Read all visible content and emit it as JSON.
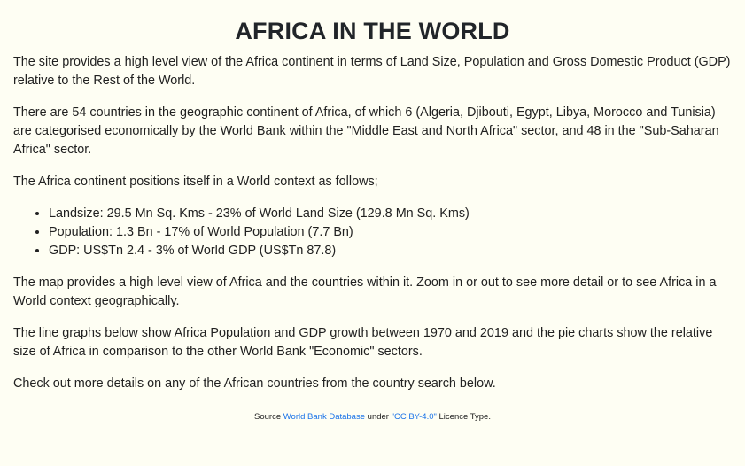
{
  "header": {
    "title": "AFRICA IN THE WORLD"
  },
  "content": {
    "p1": "The site provides a high level view of the Africa continent in terms of Land Size, Population and Gross Domestic Product (GDP) relative to the Rest of the World.",
    "p2": "There are 54 countries in the geographic continent of Africa, of which 6 (Algeria, Djibouti, Egypt, Libya, Morocco and Tunisia) are categorised economically by the World Bank within the \"Middle East and North Africa\" sector, and 48 in the \"Sub-Saharan Africa\" sector.",
    "p3": "The Africa continent positions itself in a World context as follows;",
    "bullets": [
      "Landsize: 29.5 Mn Sq. Kms - 23% of World Land Size (129.8 Mn Sq. Kms)",
      "Population: 1.3 Bn - 17% of World Population (7.7 Bn)",
      "GDP: US$Tn 2.4 - 3% of World GDP (US$Tn 87.8)"
    ],
    "p4": "The map provides a high level view of Africa and the countries within it. Zoom in or out to see more detail or to see Africa in a World context geographically.",
    "p5": "The line graphs below show Africa Population and GDP growth between 1970 and 2019 and the pie charts show the relative size of Africa in comparison to the other World Bank \"Economic\" sectors.",
    "p6": "Check out more details on any of the African countries from the country search below."
  },
  "footer": {
    "source_prefix": "Source ",
    "source_link": "World Bank Database",
    "source_middle": " under ",
    "license_link": "\"CC BY-4.0\"",
    "source_suffix": " Licence Type.",
    "link_color": "#1a73e8"
  }
}
